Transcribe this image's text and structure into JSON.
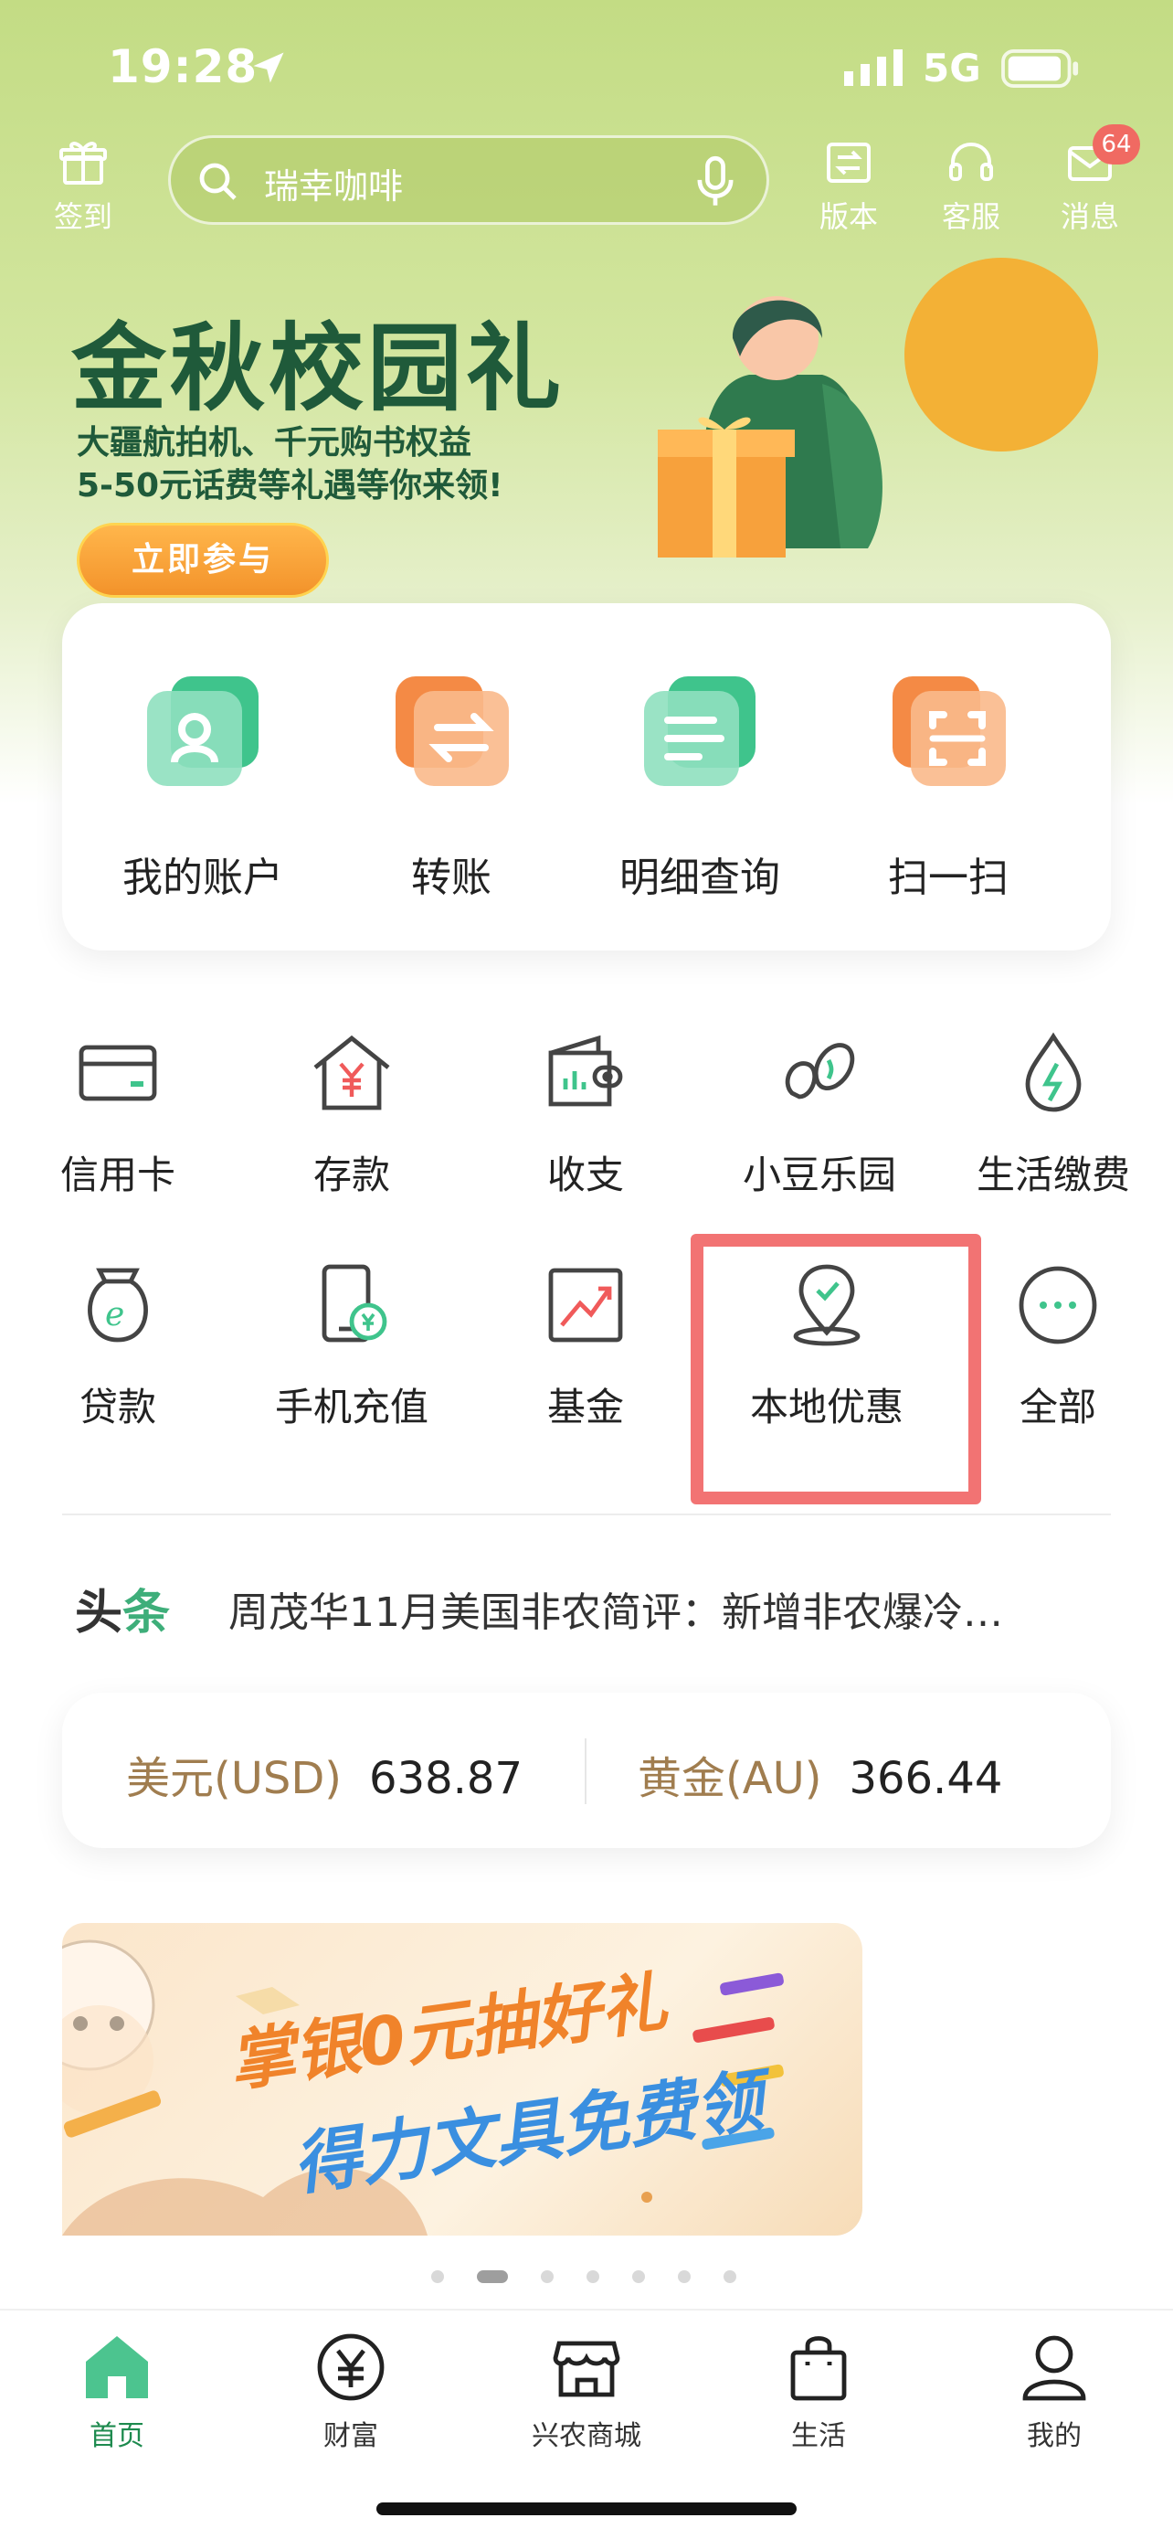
{
  "status": {
    "time": "19:28",
    "network": "5G"
  },
  "topbar": {
    "checkin_label": "签到",
    "search_placeholder": "瑞幸咖啡",
    "version_label": "版本",
    "service_label": "客服",
    "messages_label": "消息",
    "messages_badge": "64"
  },
  "banner": {
    "title": "金秋校园礼",
    "subtitle_line1": "大疆航拍机、千元购书权益",
    "subtitle_line2": "5-50元话费等礼遇等你来领!",
    "button": "立即参与"
  },
  "quick_actions": [
    {
      "label": "我的账户",
      "icon": "user-icon"
    },
    {
      "label": "转账",
      "icon": "transfer-icon"
    },
    {
      "label": "明细查询",
      "icon": "list-icon"
    },
    {
      "label": "扫一扫",
      "icon": "scan-icon"
    }
  ],
  "services": [
    {
      "label": "信用卡",
      "icon": "credit-card-icon"
    },
    {
      "label": "存款",
      "icon": "deposit-icon"
    },
    {
      "label": "收支",
      "icon": "wallet-icon"
    },
    {
      "label": "小豆乐园",
      "icon": "bean-icon"
    },
    {
      "label": "生活缴费",
      "icon": "utility-icon"
    },
    {
      "label": "贷款",
      "icon": "loan-icon"
    },
    {
      "label": "手机充值",
      "icon": "phone-topup-icon"
    },
    {
      "label": "基金",
      "icon": "fund-icon"
    },
    {
      "label": "本地优惠",
      "icon": "local-offer-icon"
    },
    {
      "label": "全部",
      "icon": "more-icon"
    }
  ],
  "news": {
    "tag_first": "头",
    "tag_second": "条",
    "headline": "周茂华11月美国非农简评：新增非农爆冷…"
  },
  "rates": [
    {
      "name": "美元(USD)",
      "value": "638.87"
    },
    {
      "name": "黄金(AU)",
      "value": "366.44"
    }
  ],
  "promo": {
    "line1": "掌银0元抽好礼",
    "line2": "得力文具免费领"
  },
  "carousel": {
    "count": 7,
    "active_index": 1
  },
  "tabs": [
    {
      "label": "首页",
      "icon": "home-icon",
      "active": true
    },
    {
      "label": "财富",
      "icon": "wealth-icon",
      "active": false
    },
    {
      "label": "兴农商城",
      "icon": "mall-icon",
      "active": false
    },
    {
      "label": "生活",
      "icon": "life-bag-icon",
      "active": false
    },
    {
      "label": "我的",
      "icon": "profile-icon",
      "active": false
    }
  ],
  "colors": {
    "brand_green": "#1d8a4e",
    "hero_green": "#c3dc84",
    "highlight_red": "#f05a5a",
    "rate_label_brown": "#a07d4f"
  }
}
